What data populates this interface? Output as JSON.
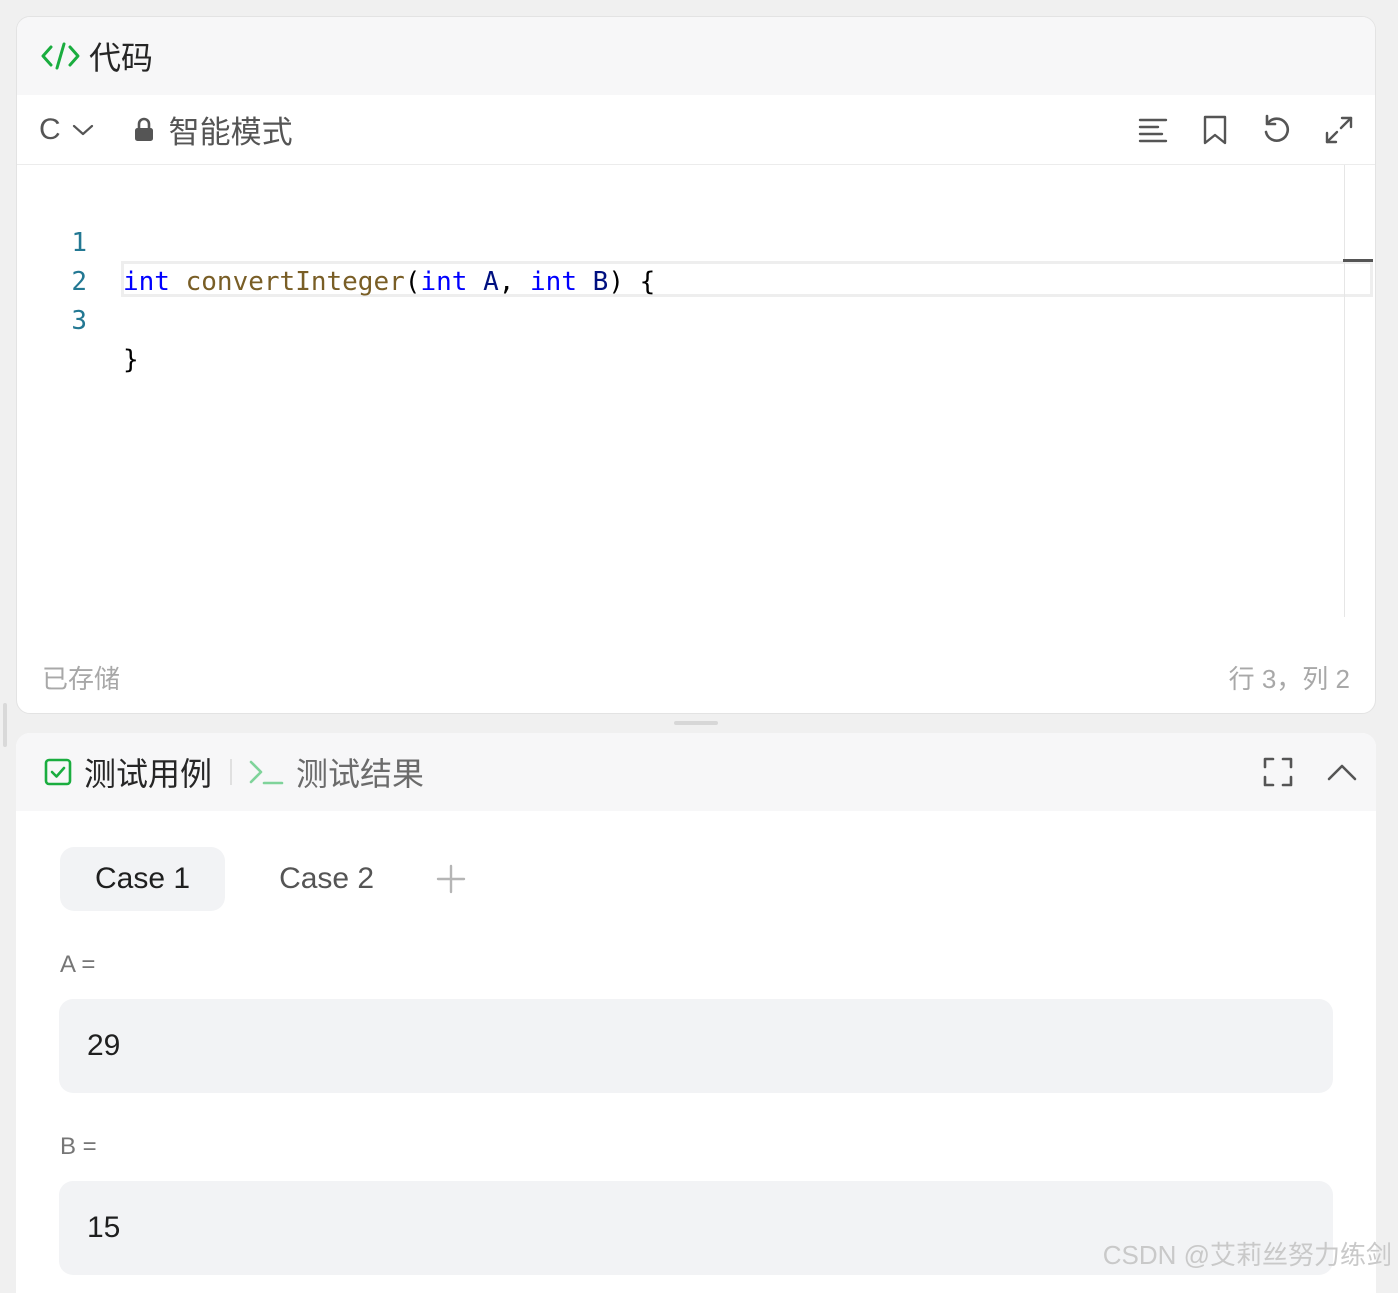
{
  "code_panel": {
    "title": "代码",
    "language": "C",
    "mode_label": "智能模式",
    "icons": {
      "title": "code-brackets-icon",
      "lock": "lock-icon",
      "format": "align-left-icon",
      "bookmark": "bookmark-icon",
      "reset": "undo-icon",
      "fullscreen": "expand-icon"
    },
    "lines": [
      {
        "number": "1"
      },
      {
        "number": "2"
      },
      {
        "number": "3"
      }
    ],
    "code_tokens": {
      "l1_kw1": "int",
      "l1_fn": "convertInteger",
      "l1_p1": "(",
      "l1_kw2": "int",
      "l1_a": "A",
      "l1_c": ", ",
      "l1_kw3": "int",
      "l1_b": "B",
      "l1_end": ") {",
      "l3": "}"
    },
    "status_saved": "已存储",
    "status_cursor": "行 3，列 2"
  },
  "test_panel": {
    "tab_cases": "测试用例",
    "tab_results": "测试结果",
    "cases": [
      {
        "label": "Case 1",
        "selected": true
      },
      {
        "label": "Case 2",
        "selected": false
      }
    ],
    "params": [
      {
        "label": "A =",
        "value": "29"
      },
      {
        "label": "B =",
        "value": "15"
      }
    ]
  },
  "colors": {
    "accent_green": "#1aad3f",
    "keyword": "#0000ff",
    "function": "#795e26",
    "identifier": "#001080",
    "line_number": "#237893"
  },
  "watermark": "CSDN @艾莉丝努力练剑"
}
